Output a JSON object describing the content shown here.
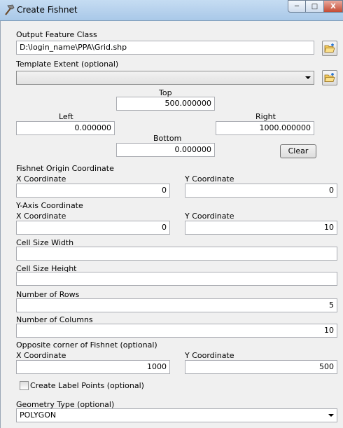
{
  "window": {
    "title": "Create Fishnet",
    "minimize_label": "─",
    "maximize_label": "□",
    "close_label": "X"
  },
  "output": {
    "label": "Output Feature Class",
    "value": "D:\\login_name\\PPA\\Grid.shp"
  },
  "template": {
    "label": "Template Extent (optional)",
    "value": ""
  },
  "extent": {
    "top_label": "Top",
    "top_value": "500.000000",
    "left_label": "Left",
    "left_value": "0.000000",
    "right_label": "Right",
    "right_value": "1000.000000",
    "bottom_label": "Bottom",
    "bottom_value": "0.000000",
    "clear_label": "Clear"
  },
  "origin": {
    "heading": "Fishnet Origin Coordinate",
    "x_label": "X Coordinate",
    "x_value": "0",
    "y_label": "Y Coordinate",
    "y_value": "0"
  },
  "yaxis": {
    "heading": "Y-Axis Coordinate",
    "x_label": "X Coordinate",
    "x_value": "0",
    "y_label": "Y Coordinate",
    "y_value": "10"
  },
  "cell_width": {
    "label": "Cell Size Width",
    "value": ""
  },
  "cell_height": {
    "label": "Cell Size Height",
    "value": ""
  },
  "rows": {
    "label": "Number of Rows",
    "value": "5"
  },
  "columns": {
    "label": "Number of Columns",
    "value": "10"
  },
  "opposite": {
    "heading": "Opposite corner of Fishnet (optional)",
    "x_label": "X Coordinate",
    "x_value": "1000",
    "y_label": "Y Coordinate",
    "y_value": "500"
  },
  "label_points": {
    "label": "Create Label Points (optional)",
    "checked": false
  },
  "geometry": {
    "label": "Geometry Type (optional)",
    "value": "POLYGON"
  },
  "icons": {
    "title": "hammer-icon",
    "browse": "open-folder-icon",
    "dropdown": "chevron-down-icon"
  }
}
